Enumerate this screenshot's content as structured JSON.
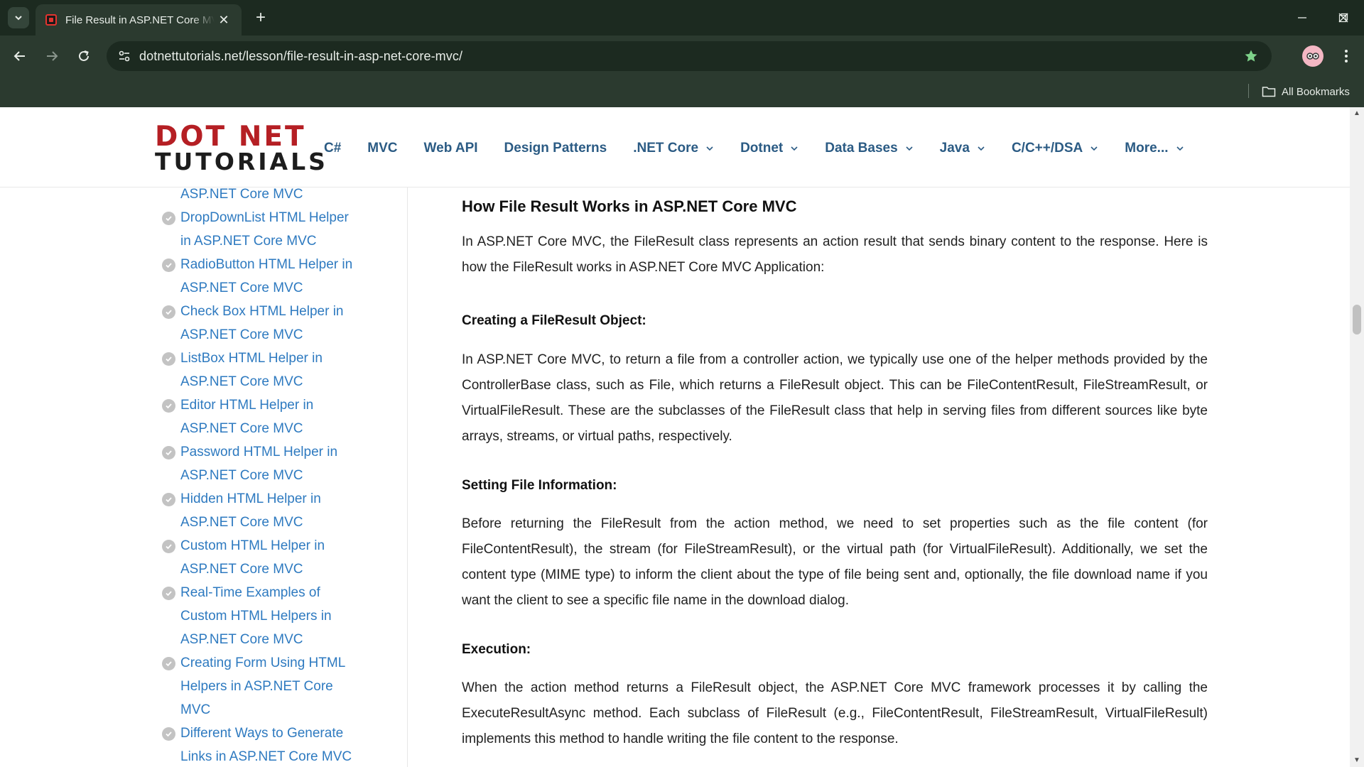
{
  "browser": {
    "tab_title": "File Result in ASP.NET Core MVC",
    "url": "dotnettutorials.net/lesson/file-result-in-asp-net-core-mvc/",
    "bookmarks_label": "All Bookmarks",
    "theme_color": "#2b3a2f",
    "tab_strip_color": "#1c2a20"
  },
  "logo": {
    "line1": "DOT NET",
    "line2": "TUTORIALS",
    "accent": "#b51f24"
  },
  "nav": {
    "items": [
      {
        "label": "C#",
        "dropdown": false
      },
      {
        "label": "MVC",
        "dropdown": false
      },
      {
        "label": "Web API",
        "dropdown": false
      },
      {
        "label": "Design Patterns",
        "dropdown": false
      },
      {
        "label": ".NET Core",
        "dropdown": true
      },
      {
        "label": "Dotnet",
        "dropdown": true
      },
      {
        "label": "Data Bases",
        "dropdown": true
      },
      {
        "label": "Java",
        "dropdown": true
      },
      {
        "label": "C/C++/DSA",
        "dropdown": true
      },
      {
        "label": "More...",
        "dropdown": true
      }
    ],
    "color": "#2b5b84"
  },
  "sidebar": {
    "partial_item": "ASP.NET Core MVC",
    "items": [
      {
        "label": "DropDownList HTML Helper in ASP.NET Core MVC"
      },
      {
        "label": "RadioButton HTML Helper in ASP.NET Core MVC"
      },
      {
        "label": "Check Box HTML Helper in ASP.NET Core MVC"
      },
      {
        "label": "ListBox HTML Helper in ASP.NET Core MVC"
      },
      {
        "label": "Editor HTML Helper in ASP.NET Core MVC"
      },
      {
        "label": "Password HTML Helper in ASP.NET Core MVC"
      },
      {
        "label": "Hidden HTML Helper in ASP.NET Core MVC"
      },
      {
        "label": "Custom HTML Helper in ASP.NET Core MVC"
      },
      {
        "label": "Real-Time Examples of Custom HTML Helpers in ASP.NET Core MVC"
      },
      {
        "label": "Creating Form Using HTML Helpers in ASP.NET Core MVC"
      },
      {
        "label": "Different Ways to Generate Links in ASP.NET Core MVC"
      }
    ],
    "link_color": "#2e7ac0"
  },
  "article": {
    "heading": "How File Result Works in ASP.NET Core MVC",
    "intro": "In ASP.NET Core MVC, the FileResult class represents an action result that sends binary content to the response. Here is how the FileResult works in ASP.NET Core MVC Application:",
    "sections": [
      {
        "title": "Creating a FileResult Object:",
        "body": "In ASP.NET Core MVC, to return a file from a controller action, we typically use one of the helper methods provided by the ControllerBase class, such as File, which returns a FileResult object. This can be FileContentResult, FileStreamResult, or VirtualFileResult. These are the subclasses of the FileResult class that help in serving files from different sources like byte arrays, streams, or virtual paths, respectively."
      },
      {
        "title": "Setting File Information:",
        "body": "Before returning the FileResult from the action method, we need to set properties such as the file content (for FileContentResult), the stream (for FileStreamResult), or the virtual path (for VirtualFileResult). Additionally, we set the content type (MIME type) to inform the client about the type of file being sent and, optionally, the file download name if you want the client to see a specific file name in the download dialog."
      },
      {
        "title": "Execution:",
        "body": "When the action method returns a FileResult object, the ASP.NET Core MVC framework processes it by calling the ExecuteResultAsync method. Each subclass of FileResult (e.g., FileContentResult, FileStreamResult, VirtualFileResult) implements this method to handle writing the file content to the response."
      }
    ]
  }
}
